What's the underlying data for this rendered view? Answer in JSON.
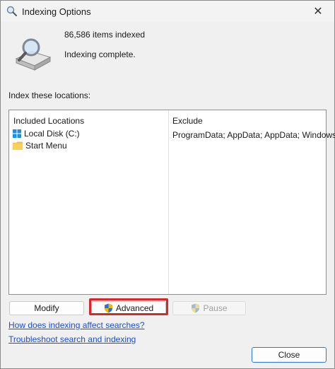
{
  "window": {
    "title": "Indexing Options",
    "close_glyph": "✕"
  },
  "status": {
    "items_indexed": "86,586 items indexed",
    "state": "Indexing complete."
  },
  "locations": {
    "section_label": "Index these locations:",
    "columns": {
      "included": "Included Locations",
      "exclude": "Exclude"
    },
    "rows": [
      {
        "label": "Local Disk (C:)",
        "icon": "drive-icon"
      },
      {
        "label": "Start Menu",
        "icon": "folder-icon"
      }
    ],
    "exclude_value": "ProgramData; AppData; AppData; Windows"
  },
  "buttons": {
    "modify": "Modify",
    "advanced": "Advanced",
    "pause": "Pause",
    "close": "Close"
  },
  "links": {
    "how_indexing": "How does indexing affect searches?",
    "troubleshoot": "Troubleshoot search and indexing"
  },
  "colors": {
    "highlight": "#d9262a",
    "link": "#1a4fd1",
    "accent": "#2d78d4"
  }
}
